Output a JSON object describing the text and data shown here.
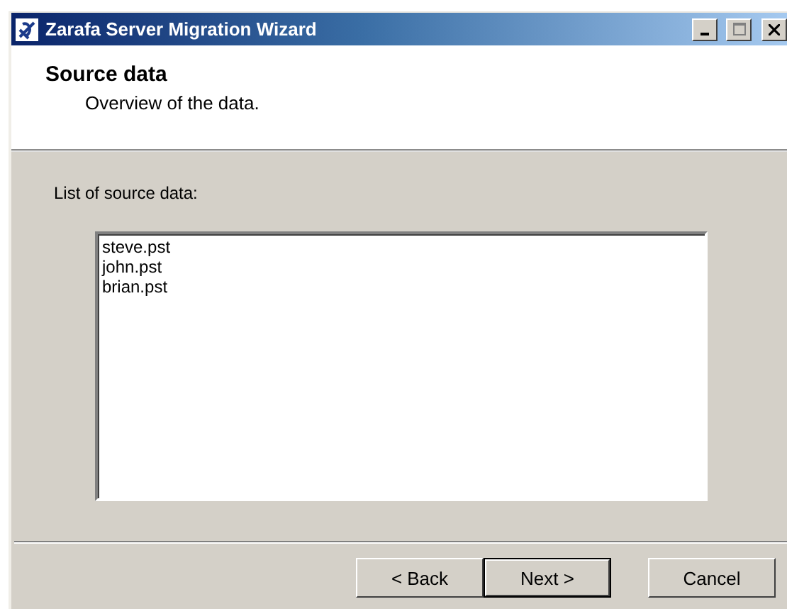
{
  "window": {
    "title": "Zarafa Server Migration Wizard"
  },
  "header": {
    "title": "Source data",
    "subtitle": "Overview of the data."
  },
  "list": {
    "label": "List of source data:",
    "items": [
      "steve.pst",
      "john.pst",
      "brian.pst"
    ]
  },
  "buttons": [
    {
      "label": "< Back",
      "default": false
    },
    {
      "label": "Next >",
      "default": true
    },
    {
      "label": "Cancel",
      "default": false
    }
  ]
}
